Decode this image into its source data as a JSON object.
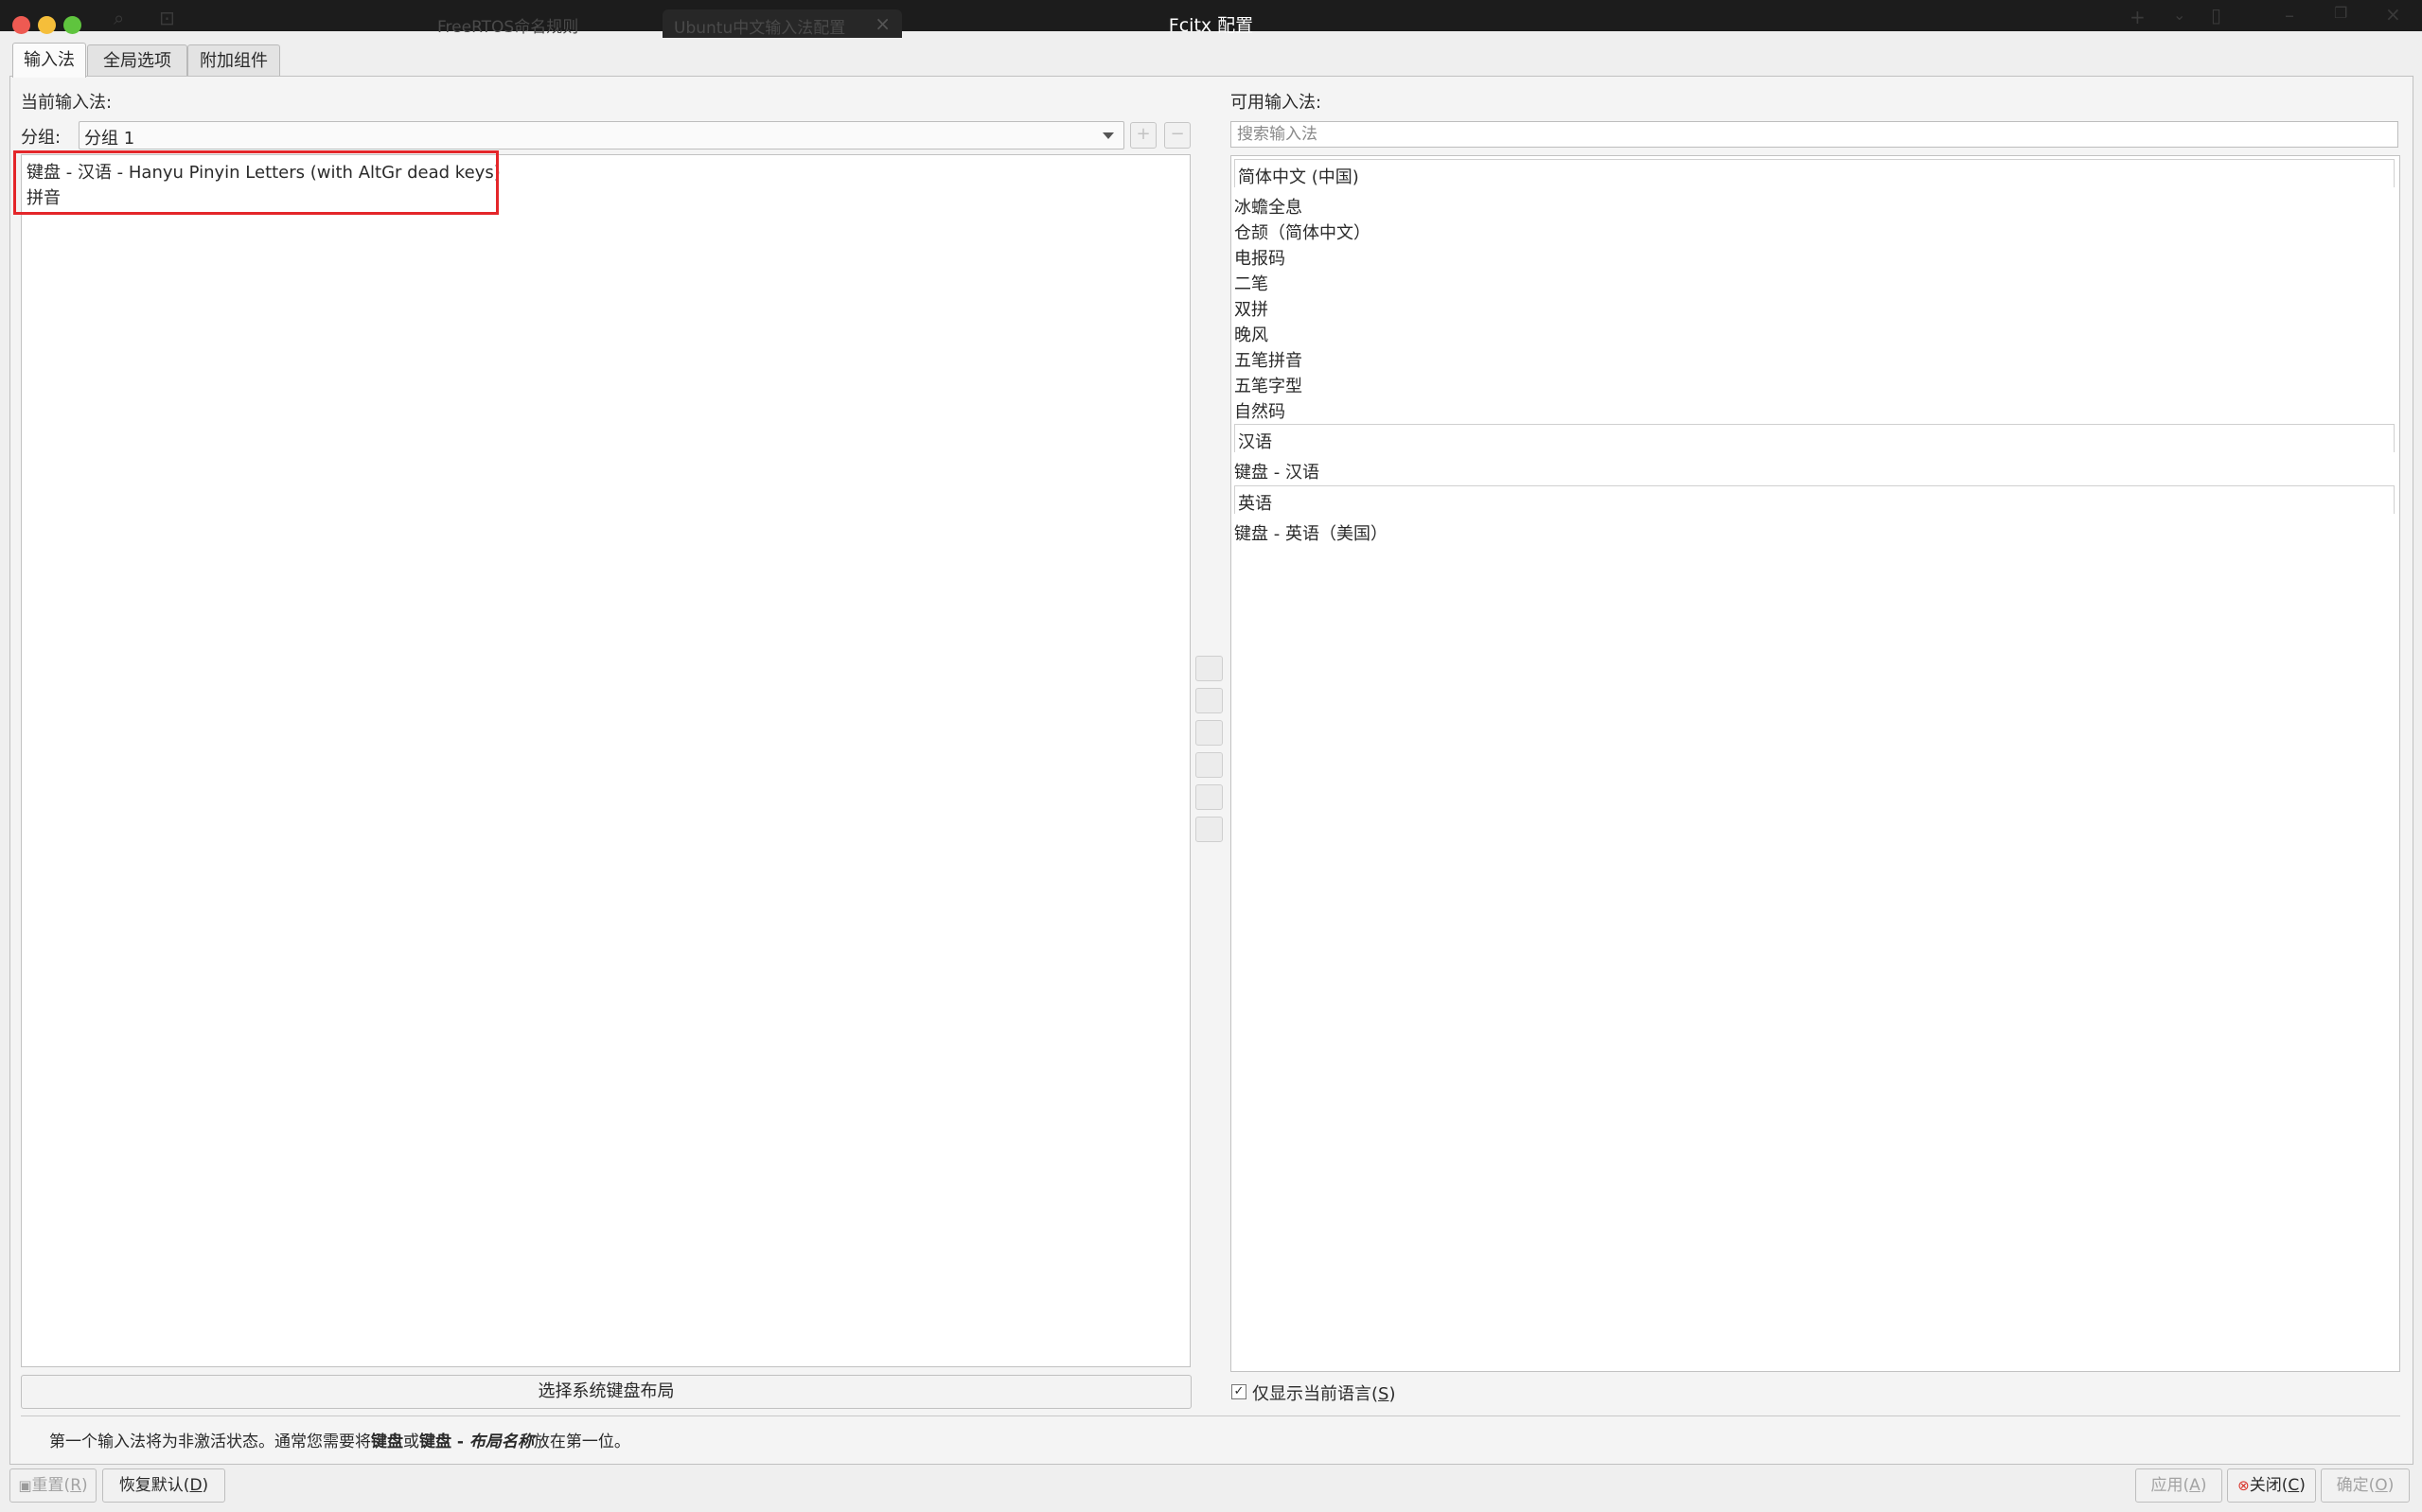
{
  "window": {
    "title": "Fcitx 配置"
  },
  "background_tabs": {
    "tab1": "FreeRTOS命名规则",
    "tab2": "Ubuntu中文输入法配置",
    "tab2_close": "×"
  },
  "tabs": [
    {
      "label": "输入法",
      "active": true
    },
    {
      "label": "全局选项",
      "active": false
    },
    {
      "label": "附加组件",
      "active": false
    }
  ],
  "left": {
    "current_label": "当前输入法:",
    "group_label": "分组:",
    "group_value": "分组 1",
    "add_symbol": "+",
    "remove_symbol": "−",
    "current_items": [
      "键盘 - 汉语 - Hanyu Pinyin Letters (with AltGr dead keys)",
      "拼音"
    ],
    "keyboard_button": "选择系统键盘布局"
  },
  "right": {
    "available_label": "可用输入法:",
    "search_placeholder": "搜索输入法",
    "groups": [
      {
        "name": "简体中文 (中国)",
        "items": [
          "冰蟾全息",
          "仓颉（简体中文）",
          "电报码",
          "二笔",
          "双拼",
          "晚风",
          "五笔拼音",
          "五笔字型",
          "自然码"
        ]
      },
      {
        "name": "汉语",
        "items": [
          "键盘 - 汉语"
        ]
      },
      {
        "name": "英语",
        "items": [
          "键盘 - 英语（美国）"
        ]
      }
    ],
    "only_current_language": "仅显示当前语言(",
    "only_current_language_key": "S",
    "only_current_language_end": ")",
    "checkbox_mark": "✓"
  },
  "hint": {
    "p1": "第一个输入法将为非激活状态。通常您需要将",
    "b1": "键盘",
    "p2": "或",
    "b2": "键盘 - ",
    "em": "布局名称",
    "p3": "放在第一位。"
  },
  "footer": {
    "reset": "重置(",
    "reset_key": "R",
    "reset_end": ")",
    "restore": "恢复默认(",
    "restore_key": "D",
    "restore_end": ")",
    "apply": "应用(",
    "apply_key": "A",
    "apply_end": ")",
    "close": "关闭(",
    "close_key": "C",
    "close_end": ")",
    "ok": "确定(",
    "ok_key": "O",
    "ok_end": ")"
  },
  "colors": {
    "highlight_box": "#e4262a",
    "close_icon": "#d9342b"
  }
}
